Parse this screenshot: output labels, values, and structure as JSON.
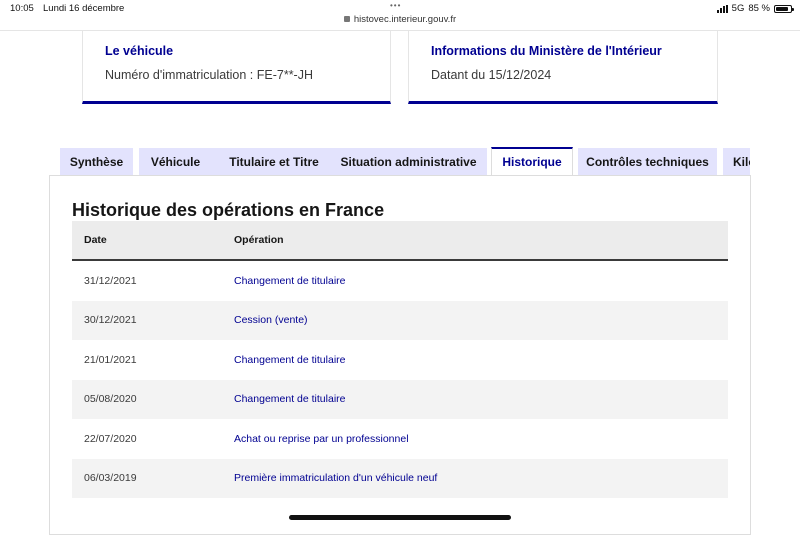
{
  "status_bar": {
    "time": "10:05",
    "date": "Lundi 16 décembre",
    "url": "histovec.interieur.gouv.fr",
    "network": "5G",
    "battery": "85 %",
    "battery_level": 0.85
  },
  "cards": [
    {
      "title": "Le véhicule",
      "text": "Numéro d'immatriculation : FE-7**-JH"
    },
    {
      "title": "Informations du Ministère de l'Intérieur",
      "text": "Datant du 15/12/2024"
    }
  ],
  "tabs": [
    {
      "label": "Synthèse"
    },
    {
      "label": "Véhicule"
    },
    {
      "label": "Titulaire et Titre"
    },
    {
      "label": "Situation administrative"
    },
    {
      "label": "Historique"
    },
    {
      "label": "Contrôles techniques"
    },
    {
      "label": "Kilométrage"
    }
  ],
  "history": {
    "title": "Historique des opérations en France",
    "columns": [
      "Date",
      "Opération"
    ],
    "rows": [
      {
        "date": "31/12/2021",
        "operation": "Changement de titulaire"
      },
      {
        "date": "30/12/2021",
        "operation": "Cession (vente)"
      },
      {
        "date": "21/01/2021",
        "operation": "Changement de titulaire"
      },
      {
        "date": "05/08/2020",
        "operation": "Changement de titulaire"
      },
      {
        "date": "22/07/2020",
        "operation": "Achat ou reprise par un professionnel"
      },
      {
        "date": "06/03/2019",
        "operation": "Première immatriculation d'un véhicule neuf"
      }
    ]
  },
  "colors": {
    "accent": "#000091",
    "tab_bg": "#e3e3fd"
  }
}
